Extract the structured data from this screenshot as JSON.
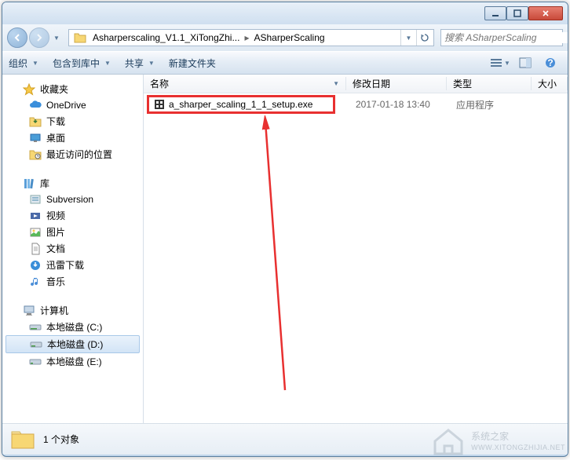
{
  "window_controls": {
    "min": "—",
    "max": "☐",
    "close": "✕"
  },
  "address": {
    "crumbs": [
      "Asharperscaling_V1.1_XiTongZhi...",
      "ASharperScaling"
    ]
  },
  "search": {
    "placeholder": "搜索 ASharperScaling"
  },
  "toolbar": {
    "organize": "组织",
    "include": "包含到库中",
    "share": "共享",
    "new_folder": "新建文件夹"
  },
  "sidebar": {
    "favorites": {
      "label": "收藏夹",
      "items": [
        "OneDrive",
        "下载",
        "桌面",
        "最近访问的位置"
      ]
    },
    "libraries": {
      "label": "库",
      "items": [
        "Subversion",
        "视频",
        "图片",
        "文档",
        "迅雷下载",
        "音乐"
      ]
    },
    "computer": {
      "label": "计算机",
      "items": [
        "本地磁盘 (C:)",
        "本地磁盘 (D:)",
        "本地磁盘 (E:)"
      ],
      "selected_index": 1
    }
  },
  "columns": {
    "name": "名称",
    "date": "修改日期",
    "type": "类型",
    "size": "大小"
  },
  "files": [
    {
      "name": "a_sharper_scaling_1_1_setup.exe",
      "date": "2017-01-18 13:40",
      "type": "应用程序"
    }
  ],
  "status": {
    "count_label": "1 个对象"
  },
  "watermark": {
    "brand": "系统之家",
    "url": "WWW.XITONGZHIJIA.NET"
  }
}
